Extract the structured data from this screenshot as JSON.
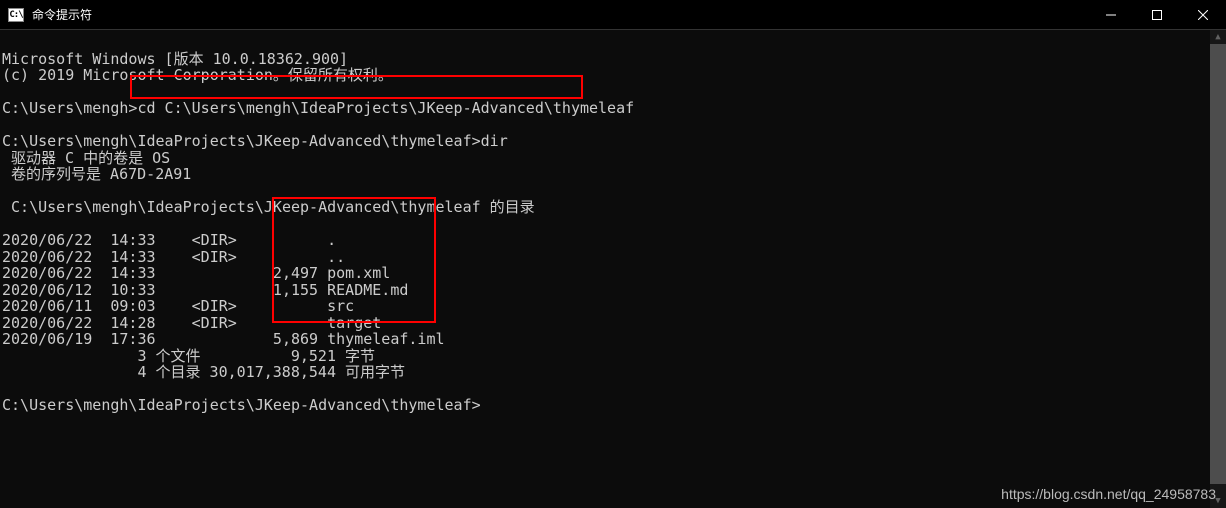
{
  "titlebar": {
    "icon_label": "C:\\",
    "title": "命令提示符"
  },
  "terminal": {
    "lines": [
      "Microsoft Windows [版本 10.0.18362.900]",
      "(c) 2019 Microsoft Corporation。保留所有权利。",
      "",
      "C:\\Users\\mengh>cd C:\\Users\\mengh\\IdeaProjects\\JKeep-Advanced\\thymeleaf",
      "",
      "C:\\Users\\mengh\\IdeaProjects\\JKeep-Advanced\\thymeleaf>dir",
      " 驱动器 C 中的卷是 OS",
      " 卷的序列号是 A67D-2A91",
      "",
      " C:\\Users\\mengh\\IdeaProjects\\JKeep-Advanced\\thymeleaf 的目录",
      "",
      "2020/06/22  14:33    <DIR>          .",
      "2020/06/22  14:33    <DIR>          ..",
      "2020/06/22  14:33             2,497 pom.xml",
      "2020/06/12  10:33             1,155 README.md",
      "2020/06/11  09:03    <DIR>          src",
      "2020/06/22  14:28    <DIR>          target",
      "2020/06/19  17:36             5,869 thymeleaf.iml",
      "               3 个文件          9,521 字节",
      "               4 个目录 30,017,388,544 可用字节",
      "",
      "C:\\Users\\mengh\\IdeaProjects\\JKeep-Advanced\\thymeleaf>"
    ]
  },
  "watermark": "https://blog.csdn.net/qq_24958783"
}
